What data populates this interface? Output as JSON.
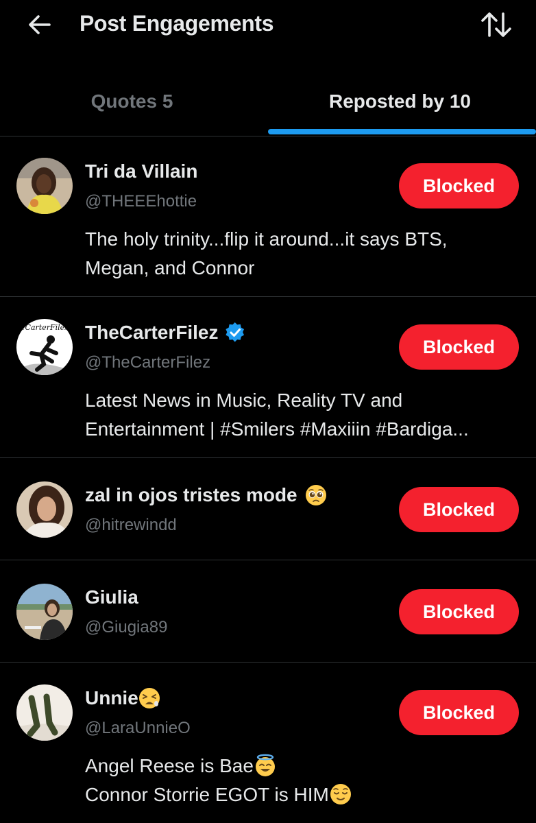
{
  "header": {
    "title": "Post Engagements",
    "back_icon": "arrow-left-icon",
    "sort_icon": "sort-arrows-icon"
  },
  "tabs": [
    {
      "label": "Quotes 5",
      "active": false
    },
    {
      "label": "Reposted by 10",
      "active": true
    }
  ],
  "colors": {
    "background": "#000000",
    "primary_text": "#e7e9ea",
    "secondary_text": "#71767b",
    "accent_blue": "#1d9bf0",
    "blocked_red": "#f4212e",
    "divider": "#2f3336"
  },
  "users": [
    {
      "name": "Tri da Villain",
      "handle": "@THEEEhottie",
      "button": "Blocked",
      "bio_lines": [
        "The holy trinity...flip it around...it says BTS,",
        "Megan, and Connor"
      ]
    },
    {
      "name": "TheCarterFilez",
      "verified": true,
      "handle": "@TheCarterFilez",
      "button": "Blocked",
      "avatar_text": "eCarterFilez",
      "bio_lines": [
        "Latest News in Music, Reality TV and",
        "Entertainment | #Smilers #Maxiiin #Bardiga..."
      ]
    },
    {
      "name": "zal in ojos tristes mode",
      "name_emoji": "pleading-face-icon",
      "handle": "@hitrewindd",
      "button": "Blocked"
    },
    {
      "name": "Giulia",
      "handle": "@Giugia89",
      "button": "Blocked"
    },
    {
      "name": "Unnie",
      "name_emoji": "tired-face-icon",
      "handle": "@LaraUnnieO",
      "button": "Blocked",
      "bio_lines": [
        "Angel Reese is Bae",
        "Connor Storrie EGOT is HIM"
      ],
      "bio_emojis": [
        "smiling-face-with-halo-icon",
        "relieved-face-icon"
      ]
    }
  ]
}
